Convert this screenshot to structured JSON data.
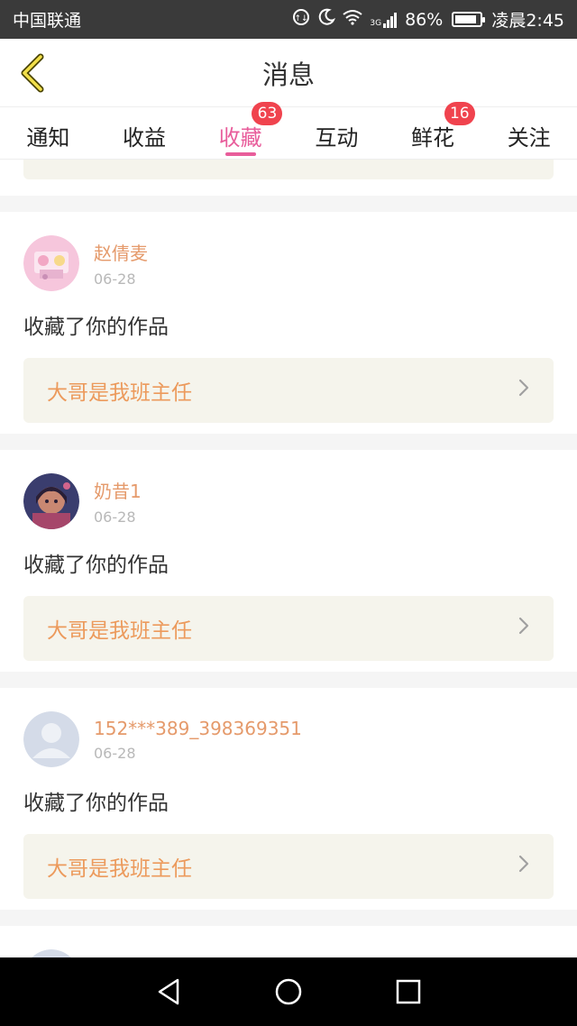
{
  "status_bar": {
    "carrier": "中国联通",
    "network": "3G",
    "battery": "86%",
    "battery_level": 0.86,
    "time": "凌晨2:45"
  },
  "header": {
    "title": "消息",
    "back_icon": "chevron-left-icon"
  },
  "tabs": [
    {
      "label": "通知",
      "badge": ""
    },
    {
      "label": "收益",
      "badge": ""
    },
    {
      "label": "收藏",
      "badge": "63",
      "active": true
    },
    {
      "label": "互动",
      "badge": ""
    },
    {
      "label": "鲜花",
      "badge": "16"
    },
    {
      "label": "关注",
      "badge": ""
    }
  ],
  "colors": {
    "accent": "#e85d9b",
    "badge": "#f0434e",
    "username": "#e59a6b",
    "work_title": "#ec9a5c",
    "work_bg": "#f5f4ec"
  },
  "messages": [
    {
      "username": "赵倩麦",
      "date": "06-28",
      "action": "收藏了你的作品",
      "work_title": "大哥是我班主任",
      "avatar": "anime-avatar-pink"
    },
    {
      "username": "奶昔1",
      "date": "06-28",
      "action": "收藏了你的作品",
      "work_title": "大哥是我班主任",
      "avatar": "anime-avatar-dark"
    },
    {
      "username": "152***389_398369351",
      "date": "06-28",
      "action": "收藏了你的作品",
      "work_title": "大哥是我班主任",
      "avatar": "default-avatar"
    }
  ],
  "nav_bar": {
    "back": "triangle-back-icon",
    "home": "circle-home-icon",
    "recent": "square-recent-icon"
  }
}
